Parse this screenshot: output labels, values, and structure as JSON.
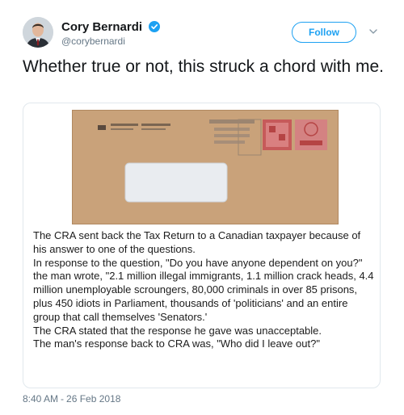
{
  "user": {
    "display_name": "Cory Bernardi",
    "handle": "@corybernardi",
    "verified_icon": "verified-badge-icon"
  },
  "follow_button": {
    "label": "Follow"
  },
  "more_menu": {
    "icon": "chevron-down-icon"
  },
  "tweet": {
    "text": "Whether true or not, this struck a chord with me."
  },
  "card": {
    "image": "envelope-photo",
    "caption_paragraphs": [
      "The CRA sent back the Tax Return to a Canadian taxpayer because of his answer to one of the questions.",
      "In response to the question, \"Do you have anyone dependent on you?\" the man wrote, \"2.1 million illegal immigrants, 1.1 million crack heads, 4.4 million unemployable scroungers, 80,000 criminals in over 85 prisons, plus 450 idiots in Parliament, thousands of 'politicians' and an entire group that call themselves 'Senators.'",
      "The CRA stated that the response he gave was unacceptable.",
      "The man's response back to CRA was, \"Who did I leave out?\""
    ]
  },
  "meta": {
    "time": "8:40 AM",
    "separator": "-",
    "date": "26 Feb 2018"
  },
  "colors": {
    "accent": "#1da1f2",
    "secondary_text": "#657786",
    "border": "#e1e8ed",
    "envelope": "#c9a27a"
  }
}
